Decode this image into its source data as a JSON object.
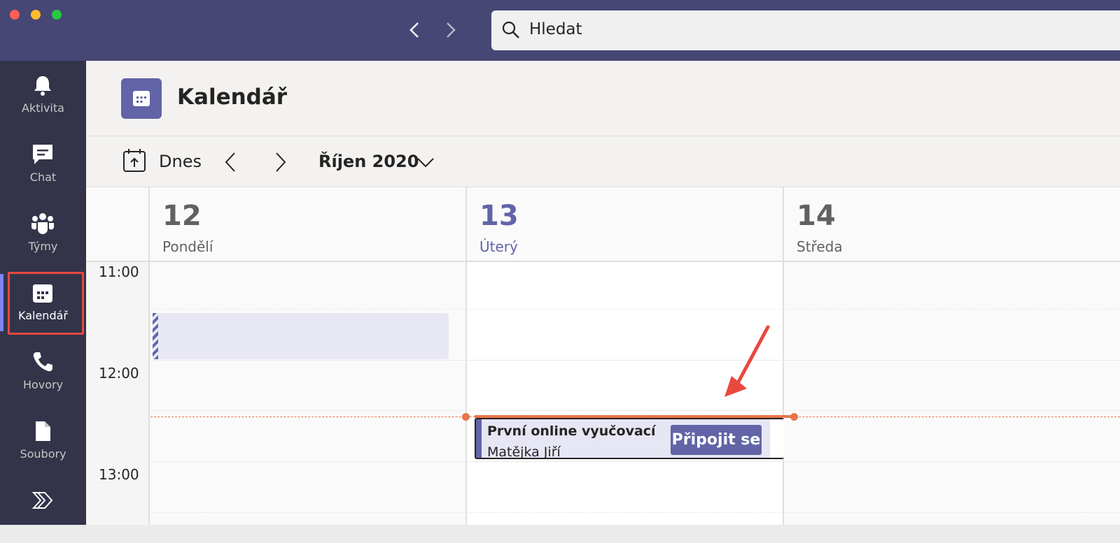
{
  "search": {
    "placeholder": "Hledat"
  },
  "rail": {
    "items": [
      {
        "label": "Aktivita"
      },
      {
        "label": "Chat"
      },
      {
        "label": "Týmy"
      },
      {
        "label": "Kalendář"
      },
      {
        "label": "Hovory"
      },
      {
        "label": "Soubory"
      }
    ]
  },
  "header": {
    "title": "Kalendář"
  },
  "toolbar": {
    "today_label": "Dnes",
    "month": "Říjen 2020"
  },
  "days": [
    {
      "num": "12",
      "weekday": "Pondělí"
    },
    {
      "num": "13",
      "weekday": "Úterý"
    },
    {
      "num": "14",
      "weekday": "Středa"
    }
  ],
  "times": [
    "11:00",
    "12:00",
    "13:00"
  ],
  "event": {
    "title": "První online vyučovací",
    "organizer": "Matějka Jiří",
    "join_label": "Připojit se"
  },
  "colors": {
    "brand": "#6264a7",
    "rail": "#33344a",
    "titlebar": "#464775",
    "now": "#e97548",
    "highlight": "#e9483f"
  }
}
